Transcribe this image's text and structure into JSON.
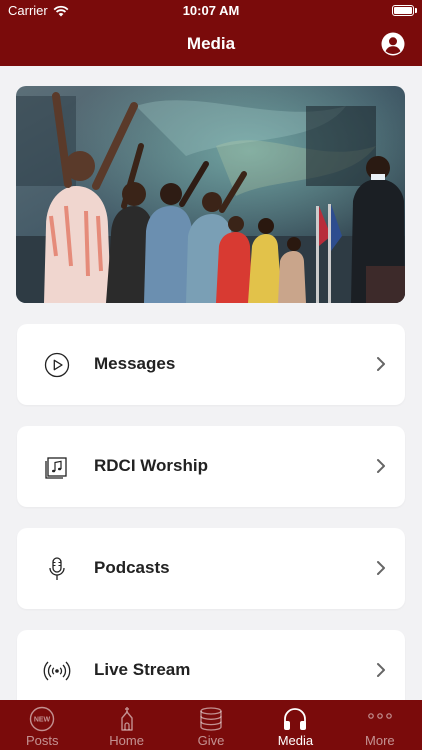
{
  "status_bar": {
    "carrier": "Carrier",
    "time": "10:07 AM"
  },
  "header": {
    "title": "Media"
  },
  "menu": [
    {
      "label": "Messages",
      "icon": "play-circle-icon"
    },
    {
      "label": "RDCI Worship",
      "icon": "music-album-icon"
    },
    {
      "label": "Podcasts",
      "icon": "microphone-icon"
    },
    {
      "label": "Live Stream",
      "icon": "broadcast-icon"
    }
  ],
  "tabs": [
    {
      "label": "Posts",
      "icon": "new-badge-icon",
      "badge": "NEW",
      "active": false
    },
    {
      "label": "Home",
      "icon": "church-icon",
      "active": false
    },
    {
      "label": "Give",
      "icon": "coins-icon",
      "active": false
    },
    {
      "label": "Media",
      "icon": "headphones-icon",
      "active": true
    },
    {
      "label": "More",
      "icon": "more-dots-icon",
      "active": false
    }
  ],
  "colors": {
    "brand": "#7a0b0b",
    "background": "#f2f2f4"
  }
}
